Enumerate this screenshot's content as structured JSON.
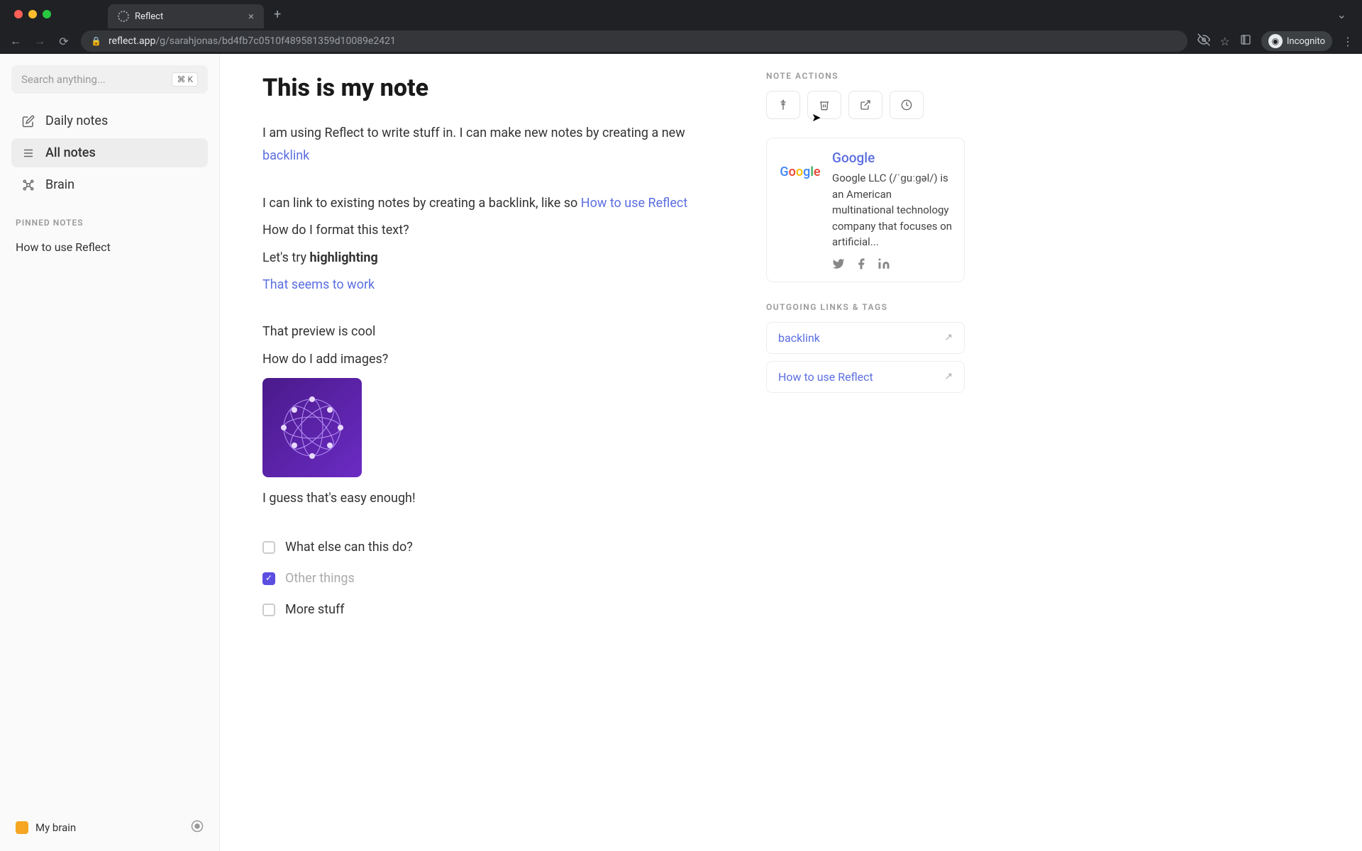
{
  "browser": {
    "tab_title": "Reflect",
    "url_host": "reflect.app",
    "url_path": "/g/sarahjonas/bd4fb7c0510f489581359d10089e2421",
    "incognito_label": "Incognito"
  },
  "sidebar": {
    "search_placeholder": "Search anything...",
    "search_kbd": "⌘ K",
    "nav": [
      {
        "label": "Daily notes",
        "active": false
      },
      {
        "label": "All notes",
        "active": true
      },
      {
        "label": "Brain",
        "active": false
      }
    ],
    "pinned_label": "PINNED NOTES",
    "pinned": [
      "How to use Reflect"
    ],
    "footer_brain": "My brain"
  },
  "note": {
    "title": "This is my note",
    "p1_prefix": "I am using Reflect to write stuff in. I can make new notes by creating a new ",
    "p1_link": "backlink",
    "p2_prefix": "I can link to existing notes by creating a backlink, like so ",
    "p2_link": "How to use Reflect",
    "p3": "How do I format this text?",
    "p4_prefix": "Let's try ",
    "p4_bold": "highlighting",
    "p5_link": "That seems to work",
    "p6": "That preview is cool",
    "p7": "How do I add images?",
    "p8": "I guess that's easy enough!",
    "checklist": [
      {
        "label": "What else can this do?",
        "checked": false
      },
      {
        "label": "Other things",
        "checked": true
      },
      {
        "label": "More stuff",
        "checked": false
      }
    ]
  },
  "right": {
    "actions_label": "NOTE ACTIONS",
    "card": {
      "title": "Google",
      "desc": "Google LLC (/ˈɡuːɡəl/) is an American multinational technology company that focuses on artificial..."
    },
    "outgoing_label": "OUTGOING LINKS & TAGS",
    "outgoing": [
      "backlink",
      "How to use Reflect"
    ]
  }
}
